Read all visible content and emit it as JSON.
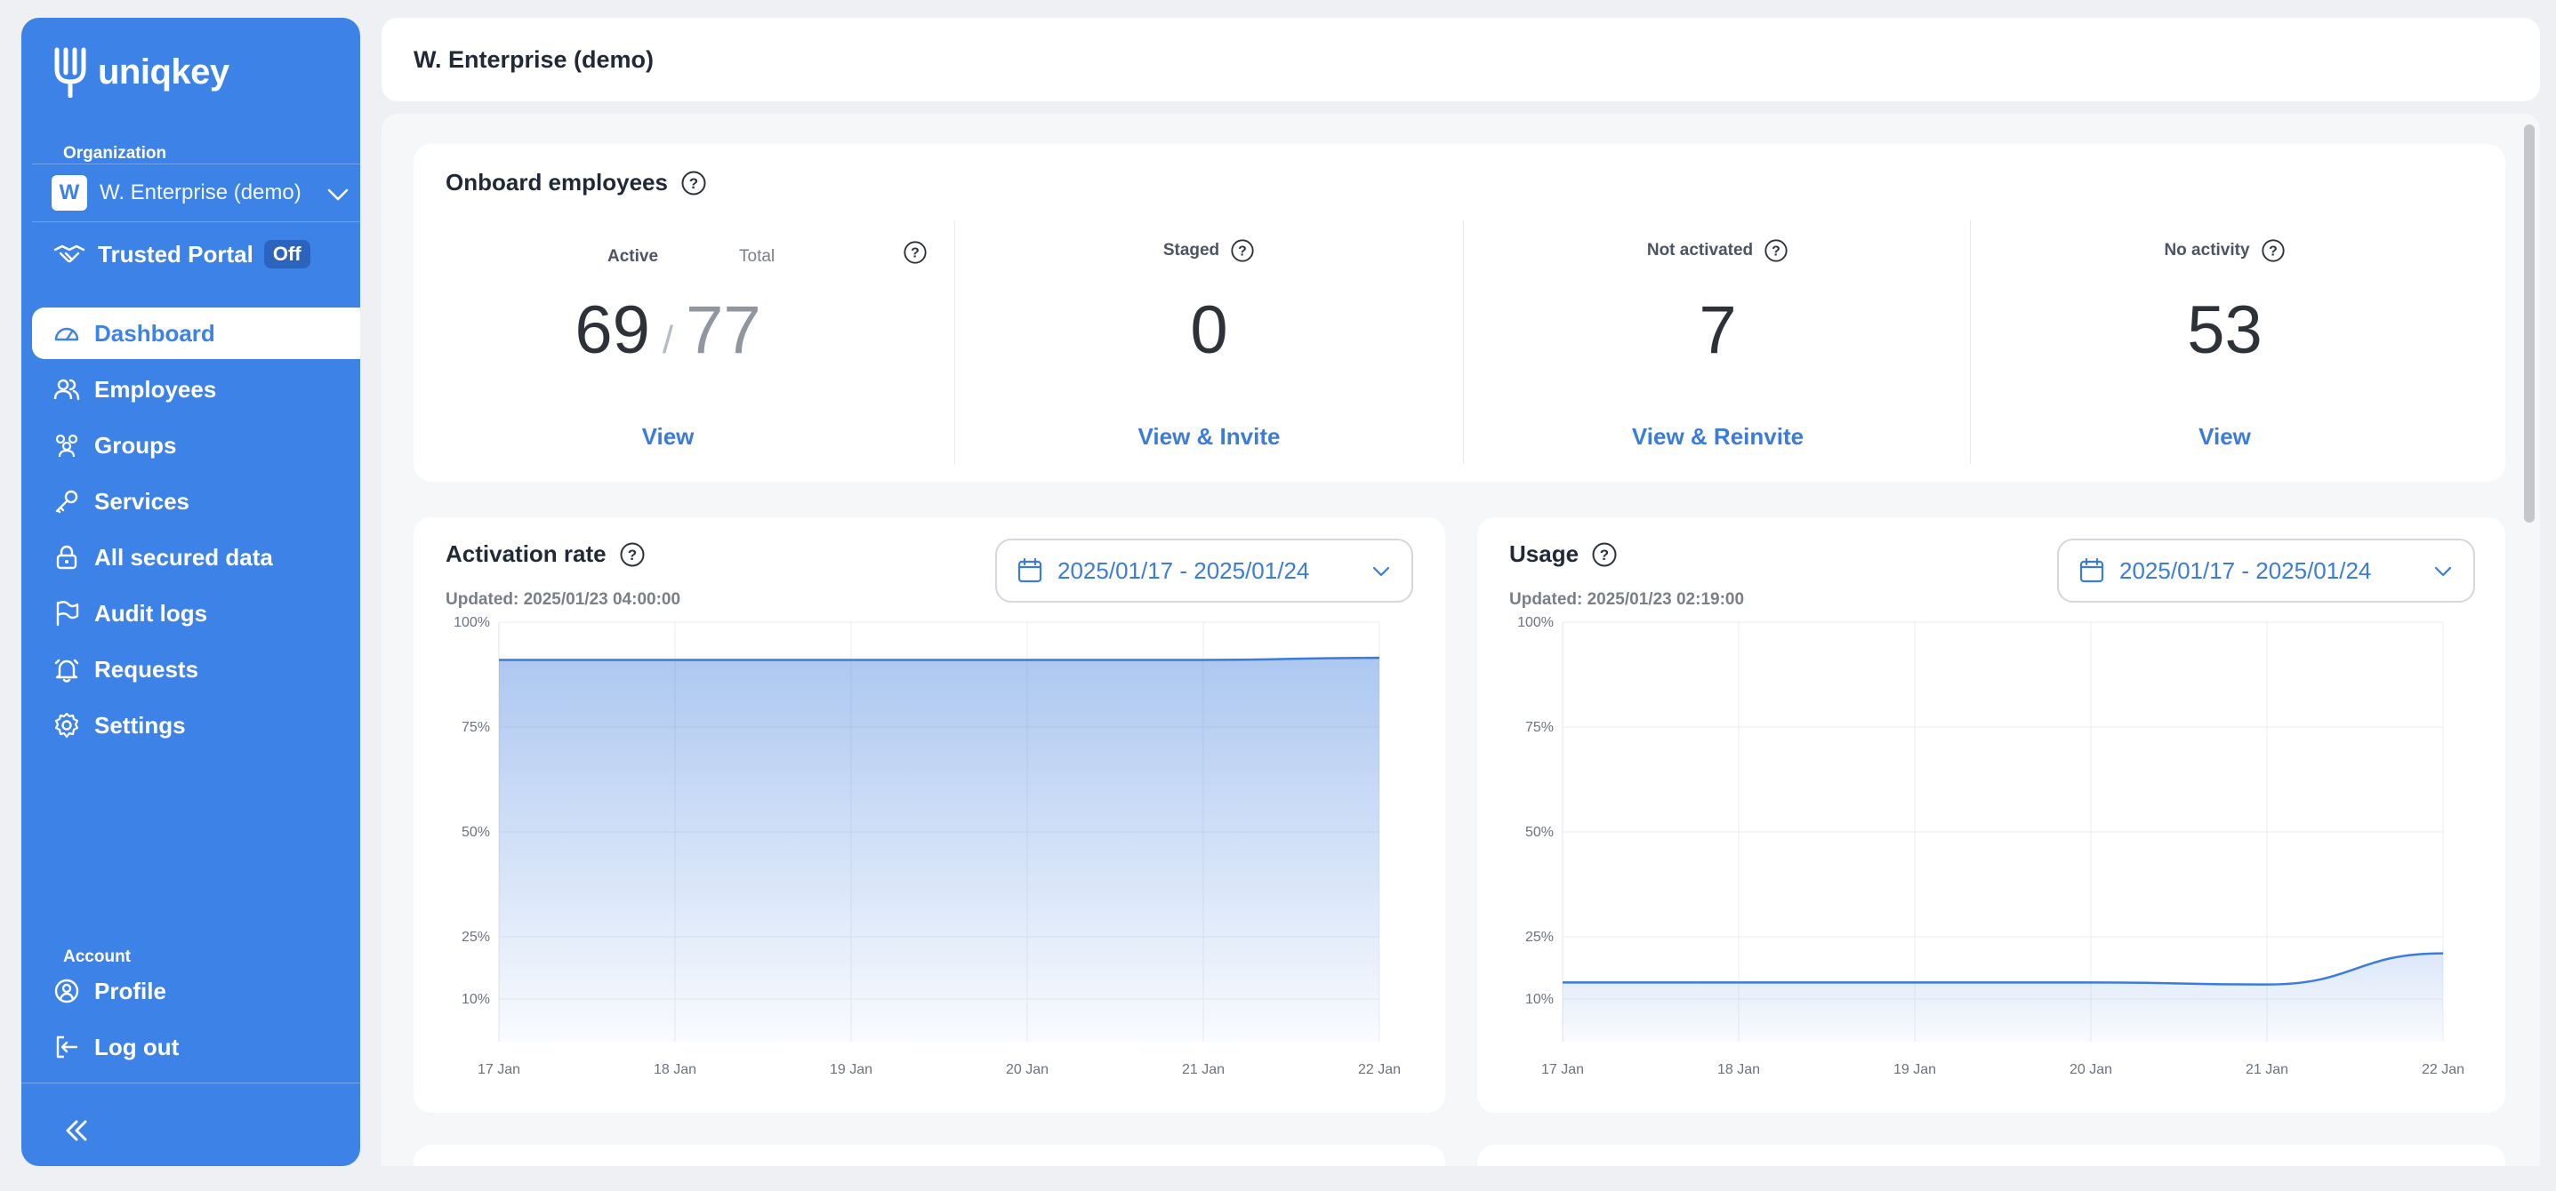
{
  "app": {
    "logo_text": "uniqkey"
  },
  "sidebar": {
    "organization_label": "Organization",
    "org": {
      "initial": "W",
      "name": "W. Enterprise (demo)"
    },
    "trusted_portal": {
      "label": "Trusted Portal",
      "status": "Off"
    },
    "items": [
      {
        "label": "Dashboard",
        "icon": "dashboard-icon",
        "active": true
      },
      {
        "label": "Employees",
        "icon": "users-icon"
      },
      {
        "label": "Groups",
        "icon": "groups-icon"
      },
      {
        "label": "Services",
        "icon": "key-icon"
      },
      {
        "label": "All secured data",
        "icon": "lock-icon"
      },
      {
        "label": "Audit logs",
        "icon": "flag-icon"
      },
      {
        "label": "Requests",
        "icon": "bell-icon"
      },
      {
        "label": "Settings",
        "icon": "gear-icon"
      }
    ],
    "account_label": "Account",
    "account_items": [
      {
        "label": "Profile",
        "icon": "profile-icon"
      },
      {
        "label": "Log out",
        "icon": "logout-icon"
      }
    ]
  },
  "header": {
    "title": "W. Enterprise (demo)"
  },
  "onboard": {
    "title": "Onboard employees",
    "stats": [
      {
        "label": "Active",
        "label2": "Total",
        "value": "69",
        "total": "77",
        "link": "View"
      },
      {
        "label": "Staged",
        "value": "0",
        "link": "View & Invite"
      },
      {
        "label": "Not activated",
        "value": "7",
        "link": "View & Reinvite"
      },
      {
        "label": "No activity",
        "value": "53",
        "link": "View"
      }
    ]
  },
  "charts": {
    "activation": {
      "title": "Activation rate",
      "updated": "Updated: 2025/01/23 04:00:00",
      "date_range": "2025/01/17 - 2025/01/24"
    },
    "usage": {
      "title": "Usage",
      "updated": "Updated: 2025/01/23 02:19:00",
      "date_range": "2025/01/17 - 2025/01/24"
    }
  },
  "chart_data": [
    {
      "type": "area",
      "title": "Activation rate",
      "x": [
        "17 Jan",
        "18 Jan",
        "19 Jan",
        "20 Jan",
        "21 Jan",
        "22 Jan"
      ],
      "y_ticks": [
        "100%",
        "75%",
        "50%",
        "25%",
        "10%"
      ],
      "ylim": [
        0,
        100
      ],
      "series": [
        {
          "values": [
            91,
            91,
            91,
            91,
            91,
            91.5
          ]
        }
      ],
      "color": "#3b7bdc"
    },
    {
      "type": "area",
      "title": "Usage",
      "x": [
        "17 Jan",
        "18 Jan",
        "19 Jan",
        "20 Jan",
        "21 Jan",
        "22 Jan"
      ],
      "y_ticks": [
        "100%",
        "75%",
        "50%",
        "25%",
        "10%"
      ],
      "ylim": [
        0,
        100
      ],
      "series": [
        {
          "values": [
            14,
            14,
            14,
            14,
            13.5,
            21
          ]
        }
      ],
      "color": "#3b7bdc"
    }
  ]
}
